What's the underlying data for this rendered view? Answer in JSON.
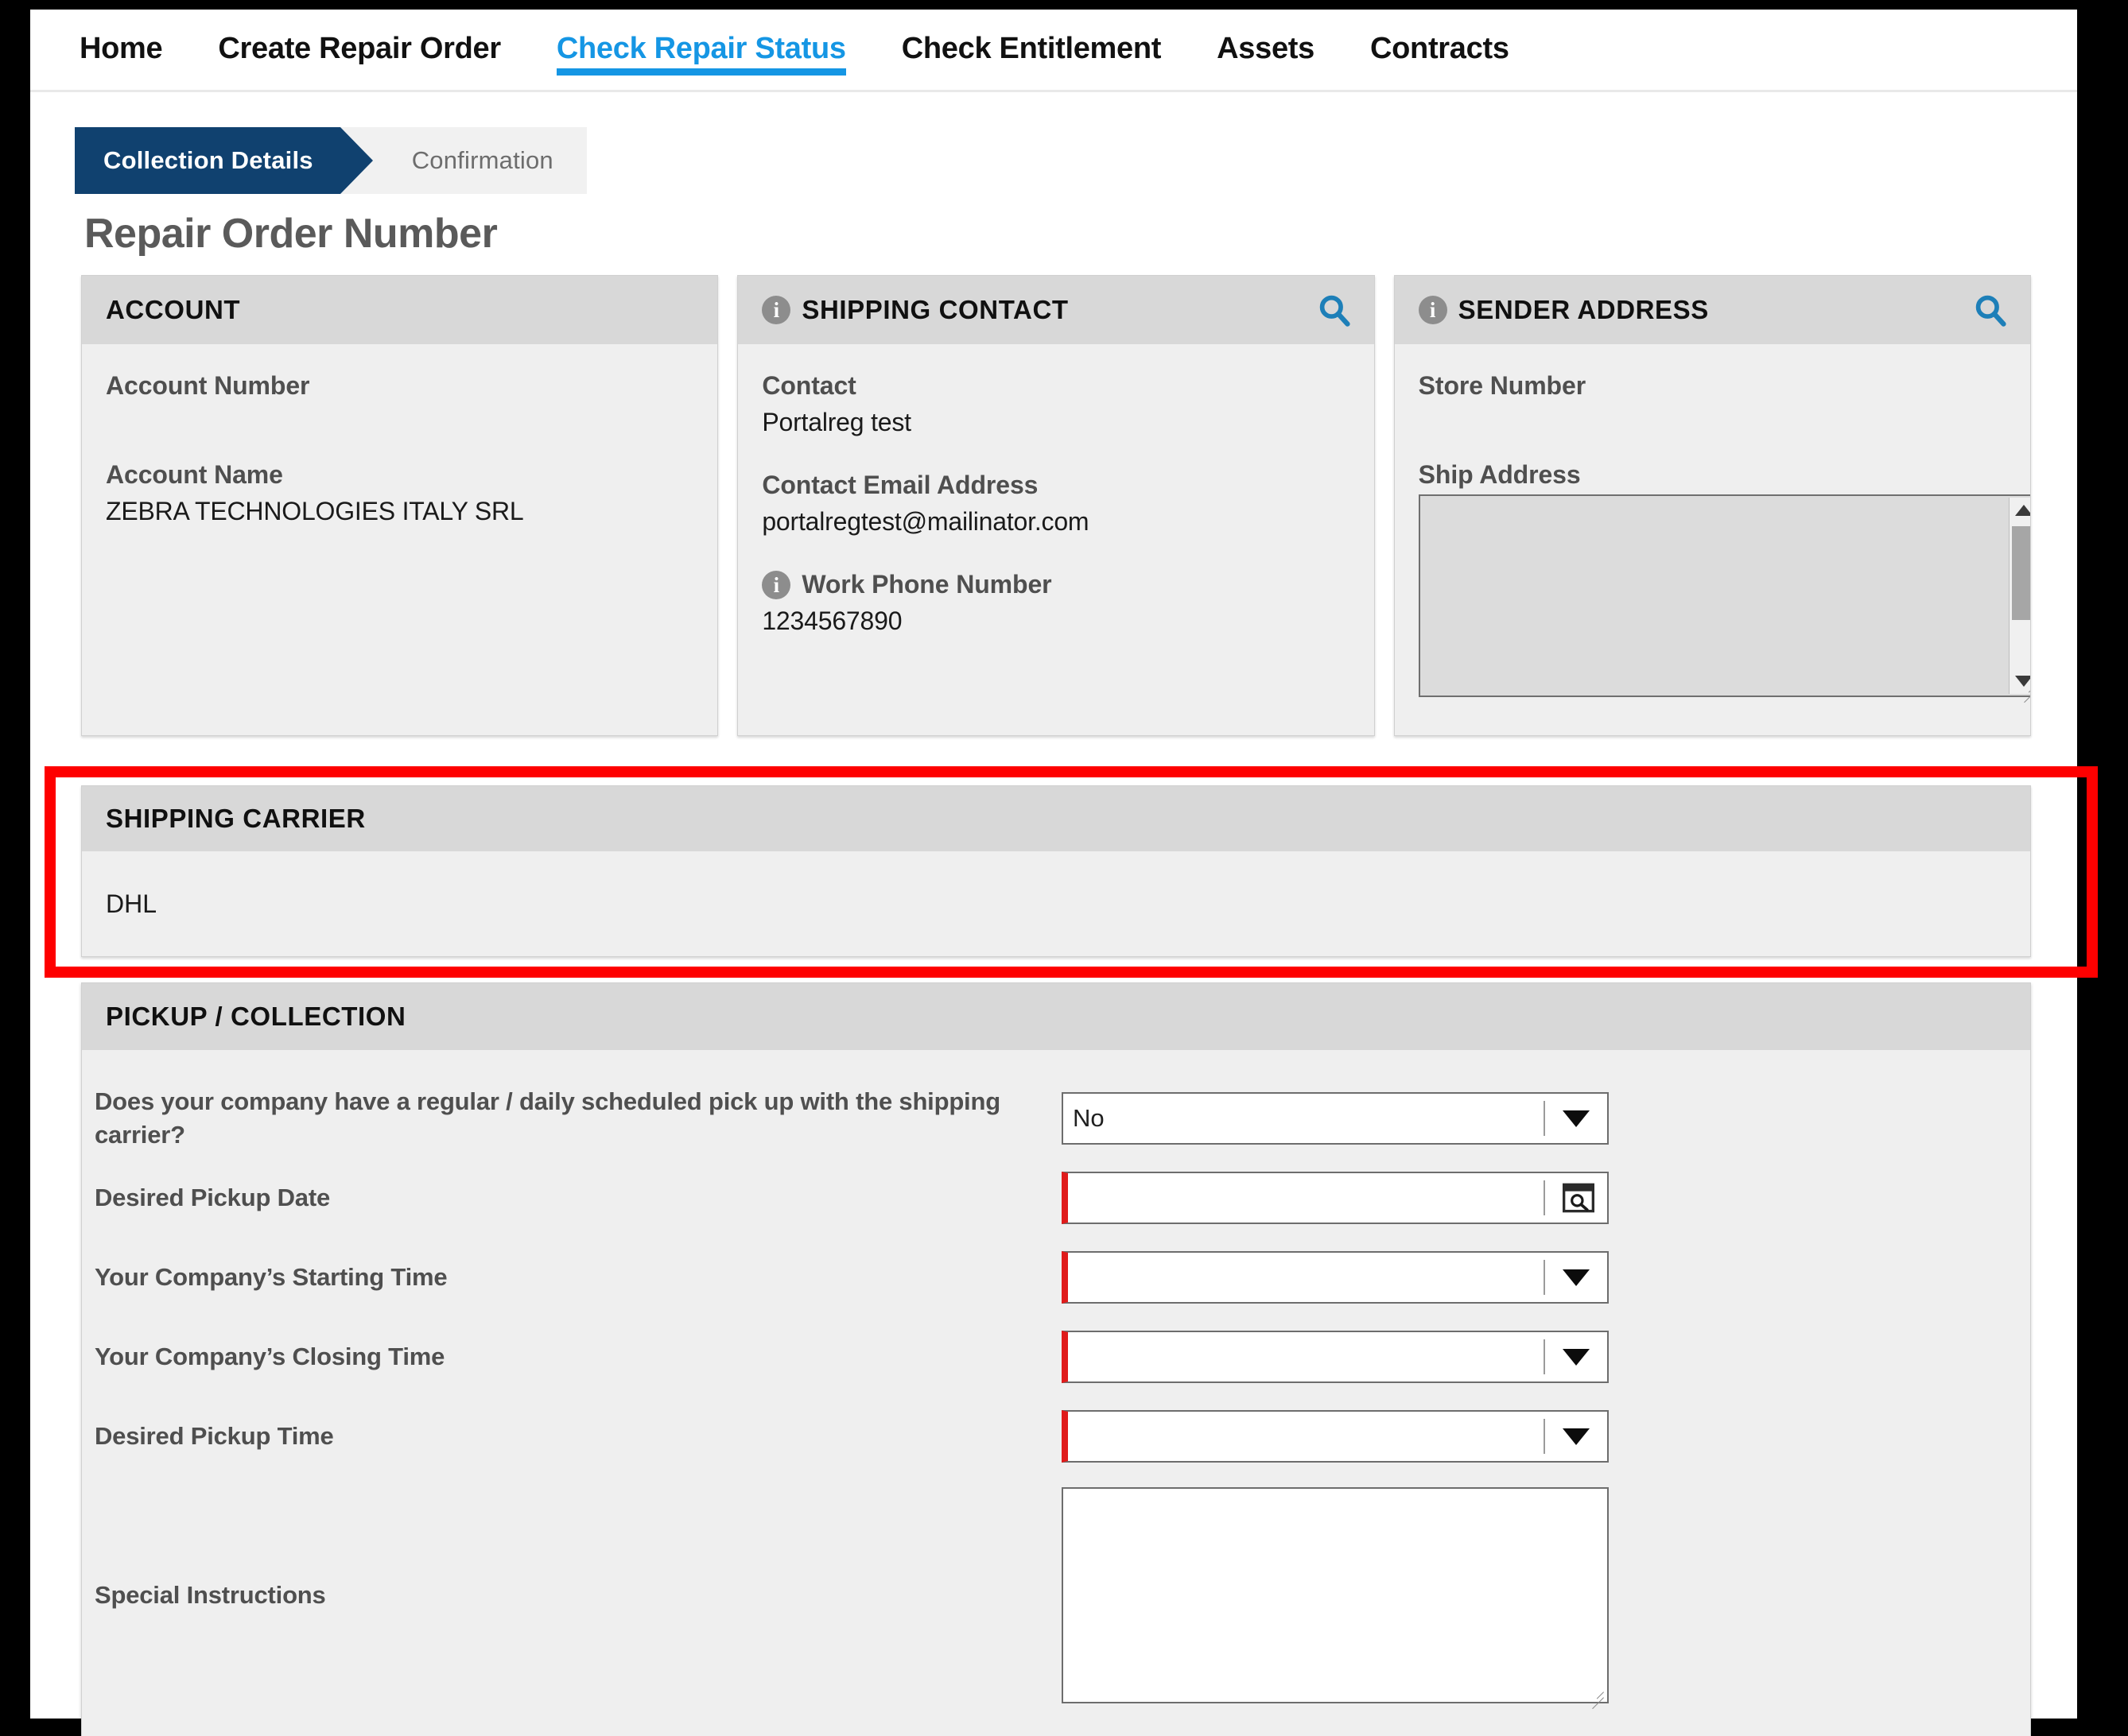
{
  "nav": {
    "items": [
      {
        "label": "Home",
        "active": false
      },
      {
        "label": "Create Repair Order",
        "active": false
      },
      {
        "label": "Check Repair Status",
        "active": true
      },
      {
        "label": "Check Entitlement",
        "active": false
      },
      {
        "label": "Assets",
        "active": false
      },
      {
        "label": "Contracts",
        "active": false
      }
    ],
    "active_color": "#1596e4"
  },
  "steps": {
    "current": "Collection Details",
    "next": "Confirmation",
    "active_color": "#10416f"
  },
  "page": {
    "title": "Repair Order Number"
  },
  "account": {
    "header": "ACCOUNT",
    "account_number_label": "Account Number",
    "account_number_value": "",
    "account_name_label": "Account Name",
    "account_name_value": "ZEBRA TECHNOLOGIES ITALY SRL"
  },
  "shipping_contact": {
    "header": "SHIPPING CONTACT",
    "info_icon": "info-icon",
    "search_icon": "search-icon",
    "contact_label": "Contact",
    "contact_value": "Portalreg test",
    "email_label": "Contact Email Address",
    "email_value": "portalregtest@mailinator.com",
    "phone_label": "Work Phone Number",
    "phone_value": "1234567890"
  },
  "sender_address": {
    "header": "SENDER ADDRESS",
    "info_icon": "info-icon",
    "search_icon": "search-icon",
    "store_number_label": "Store Number",
    "store_number_value": "",
    "ship_address_label": "Ship Address",
    "ship_address_value": ""
  },
  "shipping_carrier": {
    "header": "SHIPPING CARRIER",
    "value": "DHL",
    "highlight_color": "#fe0000"
  },
  "pickup": {
    "header": "PICKUP / COLLECTION",
    "scheduled_pickup_label": "Does your company have a regular / daily scheduled pick up with the shipping carrier?",
    "scheduled_pickup_value": "No",
    "desired_pickup_date_label": "Desired Pickup Date",
    "desired_pickup_date_value": "",
    "starting_time_label": "Your Company’s Starting Time",
    "starting_time_value": "",
    "closing_time_label": "Your Company’s Closing Time",
    "closing_time_value": "",
    "desired_pickup_time_label": "Desired Pickup Time",
    "desired_pickup_time_value": "",
    "special_instructions_label": "Special Instructions",
    "special_instructions_value": "",
    "required_marker_color": "#e01b1b"
  }
}
